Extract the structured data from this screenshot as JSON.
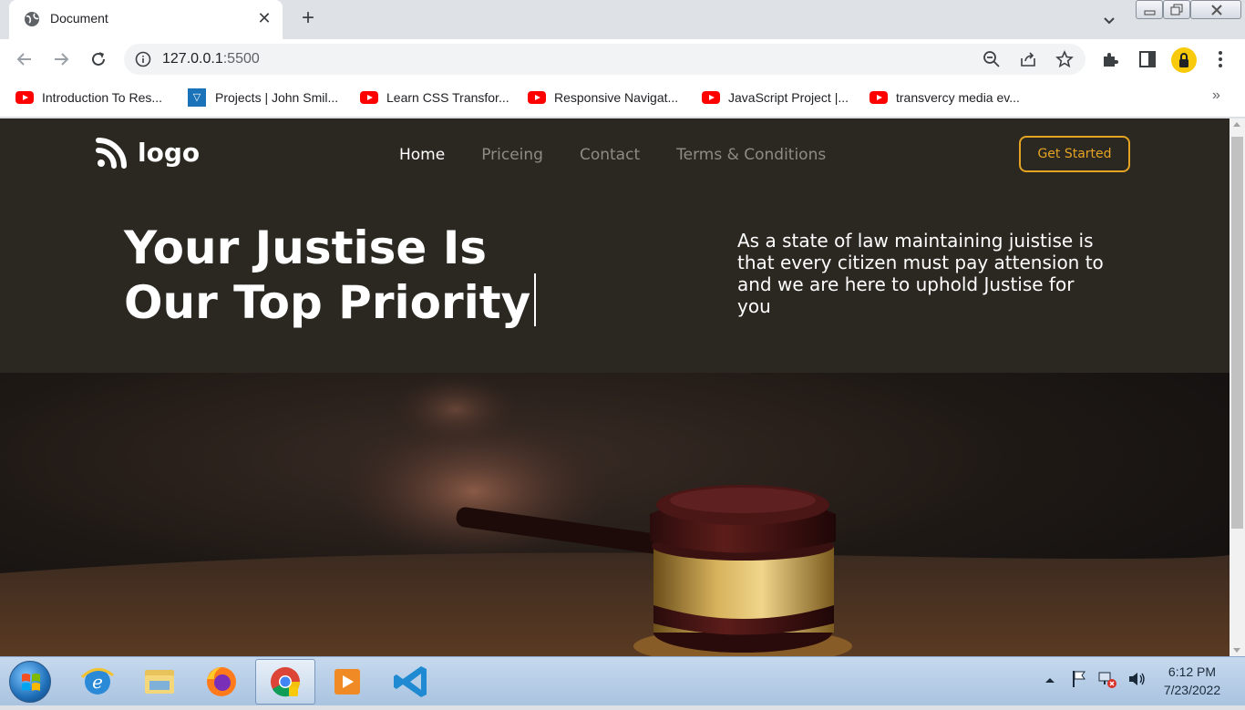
{
  "browser": {
    "tab_title": "Document",
    "url_host": "127.0.0.1",
    "url_port": ":5500",
    "bookmarks": [
      {
        "label": "Introduction To Res...",
        "icon": "youtube-icon"
      },
      {
        "label": "Projects | John Smil...",
        "icon": "vercel-icon"
      },
      {
        "label": "Learn CSS Transfor...",
        "icon": "youtube-icon"
      },
      {
        "label": "Responsive Navigat...",
        "icon": "youtube-icon"
      },
      {
        "label": "JavaScript Project |...",
        "icon": "youtube-icon"
      },
      {
        "label": "transvercy media ev...",
        "icon": "youtube-icon"
      }
    ],
    "bookmarks_more": "»"
  },
  "site": {
    "logo_text": "logo",
    "nav": [
      {
        "label": "Home",
        "active": true
      },
      {
        "label": "Priceing",
        "active": false
      },
      {
        "label": "Contact",
        "active": false
      },
      {
        "label": "Terms & Conditions",
        "active": false
      }
    ],
    "cta_label": "Get Started",
    "hero_title_line1": "Your Justise Is",
    "hero_title_line2": "Our Top Priority",
    "hero_description": "As a state of law maintaining juistise is that every citizen must pay attension to and we are here to uphold Justise for you",
    "colors": {
      "background": "#2b2822",
      "accent": "#e5a323",
      "nav_inactive": "#8f8b84"
    }
  },
  "taskbar": {
    "time": "6:12 PM",
    "date": "7/23/2022",
    "apps": [
      "internet-explorer-icon",
      "file-explorer-icon",
      "firefox-icon",
      "chrome-icon",
      "media-player-icon",
      "vscode-icon"
    ]
  }
}
